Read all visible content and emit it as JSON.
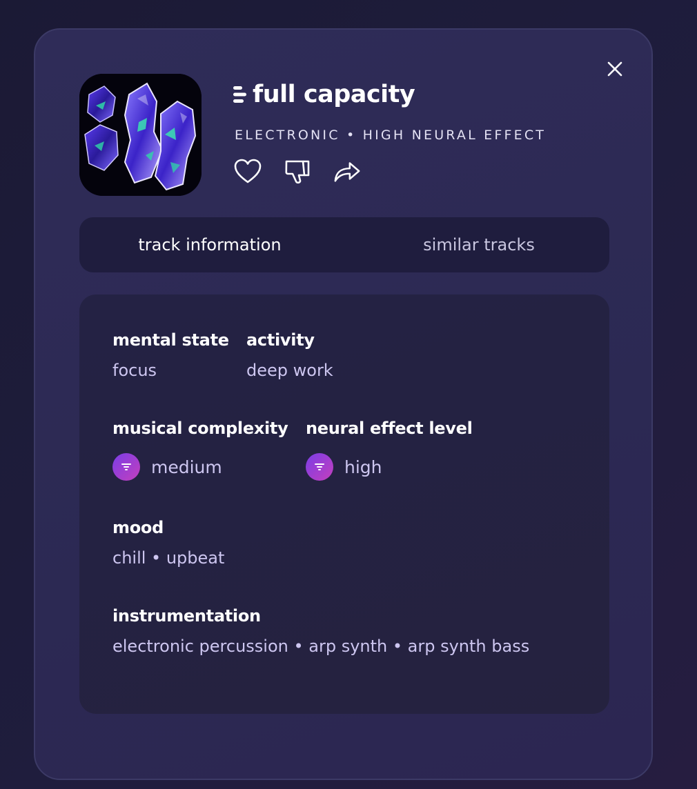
{
  "track": {
    "title": "full capacity",
    "genre": "ELECTRONIC",
    "separator": "•",
    "effect": "HIGH NEURAL EFFECT"
  },
  "icons": {
    "brand": "brand-bars-icon",
    "like": "heart-icon",
    "dislike": "thumbs-down-icon",
    "share": "share-arrow-icon",
    "close": "close-icon",
    "level": "filter-lines-icon"
  },
  "tabs": [
    {
      "label": "track information",
      "active": true
    },
    {
      "label": "similar tracks",
      "active": false
    }
  ],
  "info": {
    "mental_state": {
      "label": "mental state",
      "value": "focus"
    },
    "activity": {
      "label": "activity",
      "value": "deep work"
    },
    "musical_complexity": {
      "label": "musical complexity",
      "value": "medium"
    },
    "neural_effect_level": {
      "label": "neural effect level",
      "value": "high"
    },
    "mood": {
      "label": "mood",
      "value": "chill • upbeat"
    },
    "instrumentation": {
      "label": "instrumentation",
      "value": "electronic percussion • arp synth • arp synth bass"
    }
  },
  "colors": {
    "background": "#1d1b3a",
    "modal": "#2e2b56",
    "panel": "#242244",
    "tab_bar": "#1f1d3e",
    "badge_gradient_start": "#7a3ee6",
    "badge_gradient_end": "#c43fbd",
    "value_text": "#cdc6f0"
  }
}
